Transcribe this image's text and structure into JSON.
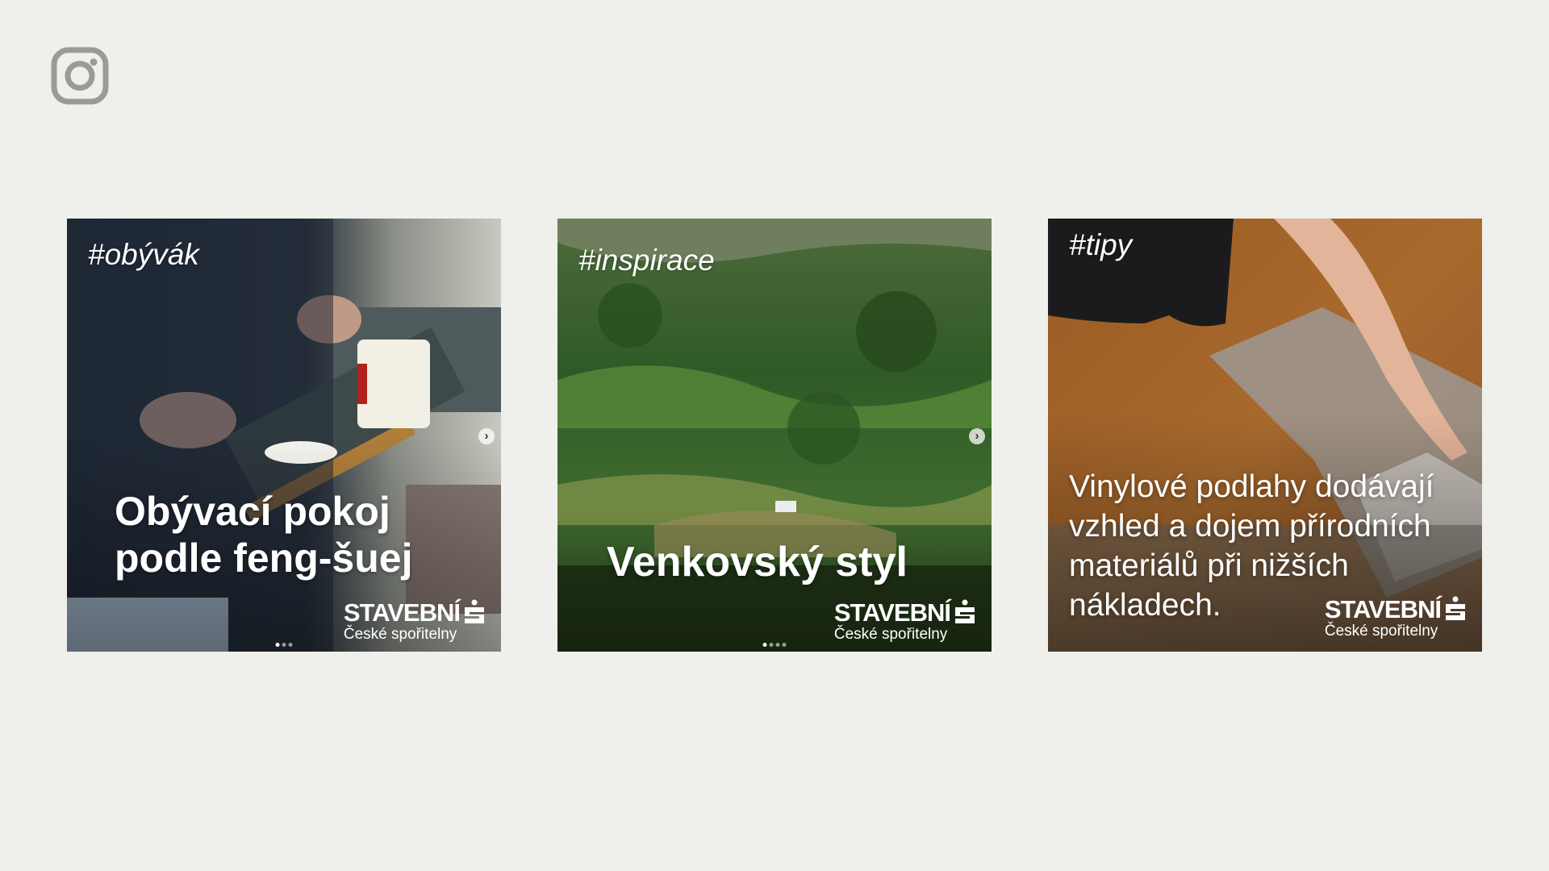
{
  "app": {
    "icon": "instagram-icon"
  },
  "posts": [
    {
      "hashtag": "#obývák",
      "headline": "Obývací pokoj podle feng-šuej",
      "brand": {
        "word": "STAVEBNÍ",
        "sub": "České spořitelny"
      },
      "carousel": {
        "dots": 3,
        "active": 1,
        "next_icon": "chevron-right-icon"
      }
    },
    {
      "hashtag": "#inspirace",
      "headline": "Venkovský styl",
      "brand": {
        "word": "STAVEBNÍ",
        "sub": "České spořitelny"
      },
      "carousel": {
        "dots": 4,
        "active": 1,
        "next_icon": "chevron-right-icon"
      }
    },
    {
      "hashtag": "#tipy",
      "headline": "Vinylové podlahy dodávají vzhled a dojem přírodních materiálů při nižších nákladech.",
      "brand": {
        "word": "STAVEBNÍ",
        "sub": "České spořitelny"
      }
    }
  ],
  "colors": {
    "background": "#efefeb",
    "icon": "#9a9a98",
    "text": "#ffffff"
  }
}
